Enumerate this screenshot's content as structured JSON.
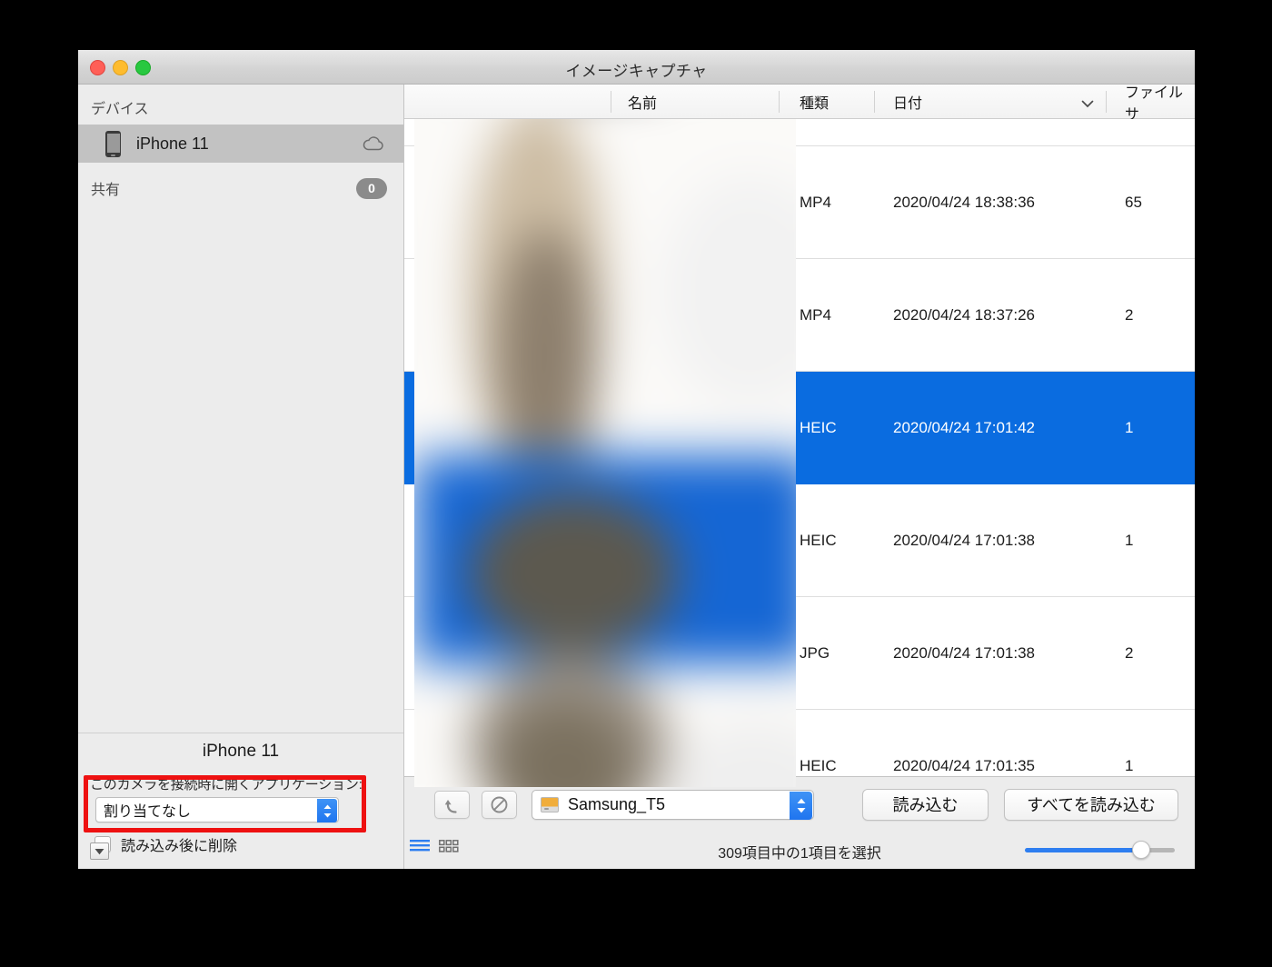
{
  "window": {
    "title": "イメージキャプチャ",
    "traffic_lights": [
      {
        "name": "close",
        "color": "#ff5f57"
      },
      {
        "name": "minimize",
        "color": "#febc2e"
      },
      {
        "name": "zoom",
        "color": "#28c840"
      }
    ]
  },
  "sidebar": {
    "devices_header": "デバイス",
    "device": {
      "label": "iPhone 11",
      "icon": "iphone-icon",
      "status_icon": "cloud-icon",
      "selected": true
    },
    "shared_header": "共有",
    "shared_count": "0"
  },
  "device_settings": {
    "title": "iPhone 11",
    "open_app_label": "このカメラを接続時に開くアプリケーション:",
    "open_app_value": "割り当てなし",
    "delete_after_import_label": "読み込み後に削除",
    "delete_after_import_checked": false,
    "disclosure_icon": "triangle-down-icon"
  },
  "table": {
    "columns": [
      {
        "key": "thumb",
        "label": ""
      },
      {
        "key": "name",
        "label": "名前"
      },
      {
        "key": "kind",
        "label": "種類"
      },
      {
        "key": "date",
        "label": "日付",
        "sorted": true,
        "sort_icon": "chevron-down-icon"
      },
      {
        "key": "size",
        "label": "ファイルサ"
      }
    ],
    "rows": [
      {
        "name": "",
        "kind": "",
        "date": "",
        "size": "",
        "selected": false,
        "partial": true
      },
      {
        "name": "",
        "kind": "MP4",
        "date": "2020/04/24 18:38:36",
        "size": "65",
        "selected": false
      },
      {
        "name": "",
        "kind": "MP4",
        "date": "2020/04/24 18:37:26",
        "size": "2",
        "selected": false
      },
      {
        "name": "",
        "kind": "HEIC",
        "date": "2020/04/24 17:01:42",
        "size": "1",
        "selected": true
      },
      {
        "name": "",
        "kind": "HEIC",
        "date": "2020/04/24 17:01:38",
        "size": "1",
        "selected": false
      },
      {
        "name": "",
        "kind": "JPG",
        "date": "2020/04/24 17:01:38",
        "size": "2",
        "selected": false
      },
      {
        "name": "",
        "kind": "HEIC",
        "date": "2020/04/24 17:01:35",
        "size": "1",
        "selected": false
      }
    ],
    "selection_color": "#0a6ce0"
  },
  "toolbar": {
    "rotate_icon": "rotate-left-icon",
    "delete_icon": "no-entry-icon",
    "destination_value": "Samsung_T5",
    "destination_icon": "external-drive-icon",
    "import_label": "読み込む",
    "import_all_label": "すべてを読み込む"
  },
  "status_bar": {
    "list_view_icon": "list-view-icon",
    "grid_view_icon": "grid-view-icon",
    "active_view": "list",
    "status": "309項目中の1項目を選択",
    "zoom_value": 77
  },
  "annotation": {
    "type": "red-rectangle",
    "color": "#ee1111",
    "targets": "読み込み後に削除"
  }
}
